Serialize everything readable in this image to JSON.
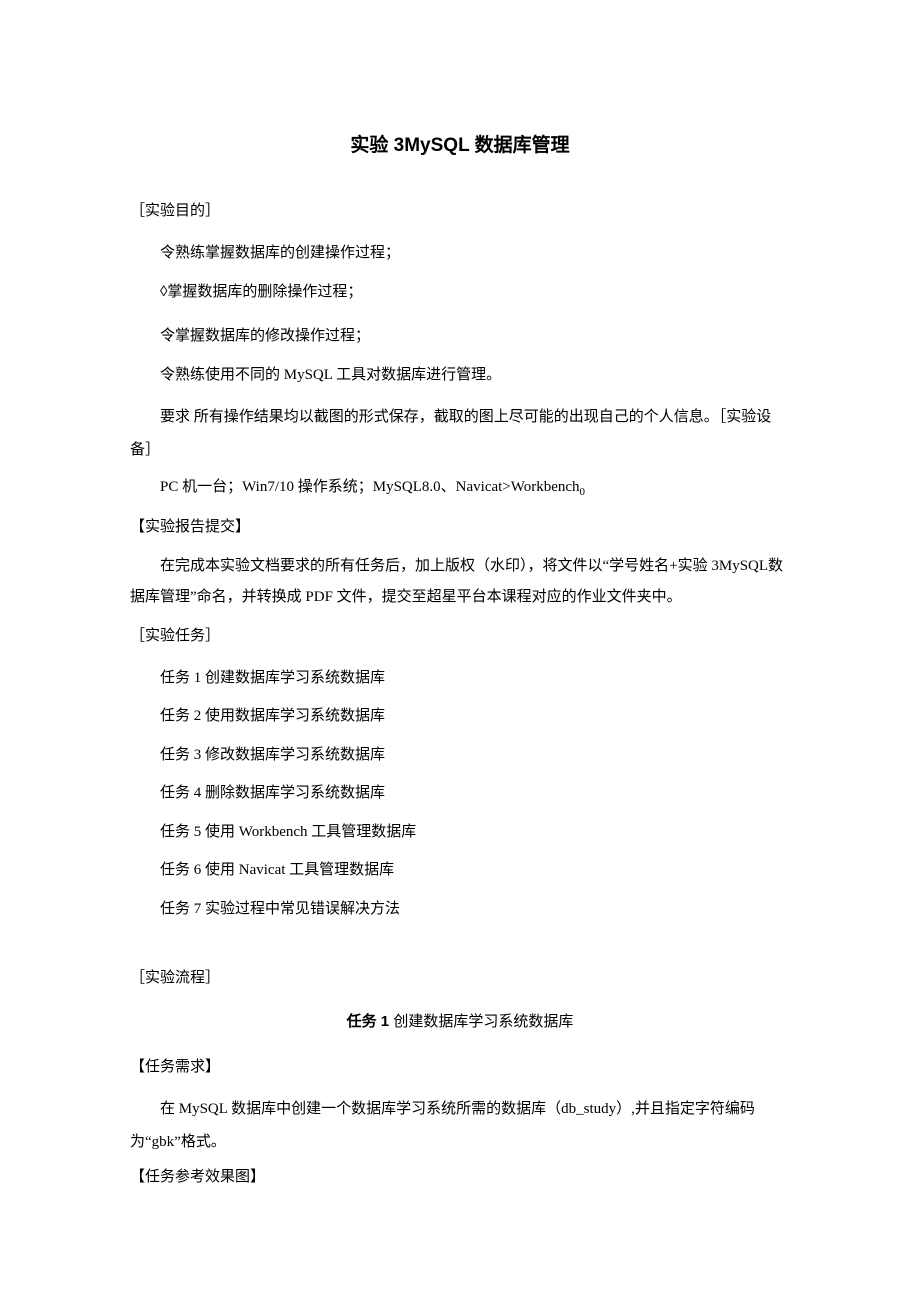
{
  "title": "实验 3MySQL 数据库管理",
  "sections": {
    "purpose_header": "［实验目的］",
    "purpose_items": [
      "令熟练掌握数据库的创建操作过程；",
      "◊掌握数据库的删除操作过程；",
      "令掌握数据库的修改操作过程；",
      "令熟练使用不同的 MySQL 工具对数据库进行管理。"
    ],
    "requirement_prefix": "要求  所有操作结果均以截图的形式保存，截取的图上尽可能的出现自己的个人信息。［实验设备］",
    "equipment_line_a": "PC 机一台；Win7/10 操作系统；MySQL8.0、Navicat>Workbench",
    "equipment_sub": "0",
    "report_header": "【实验报告提交】",
    "report_body": "在完成本实验文档要求的所有任务后，加上版权（水印），将文件以“学号姓名+实验 3MySQL数据库管理”命名，并转换成 PDF 文件，提交至超星平台本课程对应的作业文件夹中。",
    "tasks_header": "［实验任务］",
    "tasks": [
      "任务 1 创建数据库学习系统数据库",
      "任务 2 使用数据库学习系统数据库",
      "任务 3 修改数据库学习系统数据库",
      "任务 4 删除数据库学习系统数据库",
      "任务 5 使用 Workbench 工具管理数据库",
      "任务 6 使用 Navicat 工具管理数据库",
      "任务 7 实验过程中常见错误解决方法"
    ],
    "flow_header": "［实验流程］",
    "task1_title_bold": "任务 1 ",
    "task1_title_rest": "创建数据库学习系统数据库",
    "req_header": "【任务需求】",
    "req_body": "在 MySQL 数据库中创建一个数据库学习系统所需的数据库（db_study）,并且指定字符编码为“gbk”格式。",
    "effect_header": "【任务参考效果图】"
  }
}
